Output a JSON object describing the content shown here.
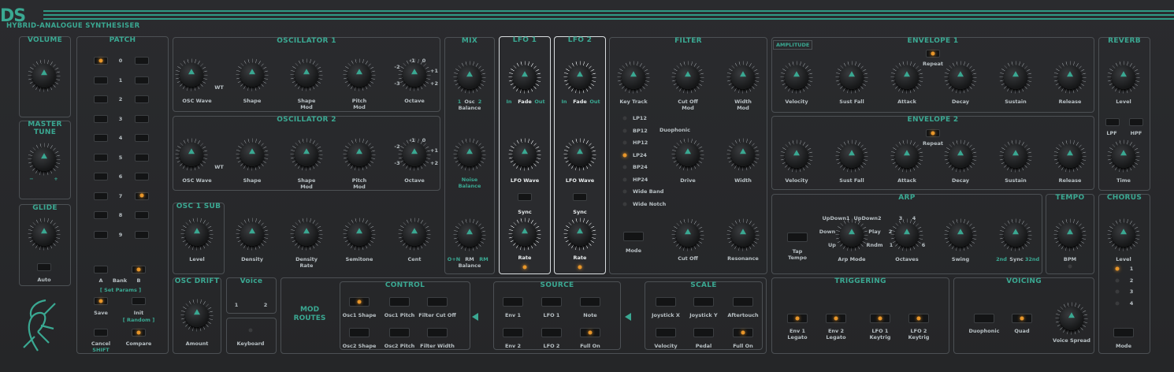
{
  "brand": {
    "logo": "DS",
    "subtitle": "HYBRID-ANALOGUE SYNTHESISER"
  },
  "sections": {
    "volume": "VOLUME",
    "master_tune": "MASTER TUNE",
    "glide": "GLIDE",
    "patch": "PATCH",
    "osc1": "OSCILLATOR 1",
    "osc2": "OSCILLATOR 2",
    "osc1_sub": "OSC 1 SUB",
    "osc_drift": "OSC DRIFT",
    "mix": "MIX",
    "lfo1": "LFO 1",
    "lfo2": "LFO 2",
    "filter": "FILTER",
    "amplitude": "AMPLITUDE",
    "env1": "ENVELOPE 1",
    "env2": "ENVELOPE 2",
    "reverb": "REVERB",
    "arp": "ARP",
    "tempo": "TEMPO",
    "chorus": "CHORUS",
    "control": "CONTROL",
    "source": "SOURCE",
    "scale": "SCALE",
    "triggering": "TRIGGERING",
    "voicing": "VOICING",
    "voice": "Voice"
  },
  "master": {
    "tune_minus": "−",
    "tune_plus": "+",
    "glide_auto": "Auto"
  },
  "patch": {
    "numbers": [
      "0",
      "1",
      "2",
      "3",
      "4",
      "5",
      "6",
      "7",
      "8",
      "9"
    ],
    "a": "A",
    "bank": "Bank",
    "b": "B",
    "set_params": "[ Set Params ]",
    "save": "Save",
    "init": "Init",
    "random": "[ Random ]",
    "cancel": "Cancel",
    "shift": "SHIFT",
    "compare": "Compare"
  },
  "osc1": {
    "wave": "OSC Wave",
    "wt": "WT",
    "shape": "Shape",
    "shape_mod": "Shape\nMod",
    "pitch_mod": "Pitch\nMod",
    "octave": "Octave",
    "oct": [
      "-2",
      "-1",
      "0",
      "+1",
      "+2",
      "-3"
    ]
  },
  "osc2": {
    "wave": "OSC Wave",
    "wt": "WT",
    "shape": "Shape",
    "shape_mod": "Shape\nMod",
    "pitch_mod": "Pitch\nMod",
    "octave": "Octave",
    "oct": [
      "-2",
      "-1",
      "0",
      "+1",
      "+2",
      "-3"
    ]
  },
  "sub": {
    "level": "Level",
    "density": "Density",
    "density_rate": "Density\nRate",
    "semitone": "Semitone",
    "cent": "Cent"
  },
  "drift": {
    "amount": "Amount",
    "keyboard": "Keyboard",
    "voice1": "1",
    "voice2": "2"
  },
  "mix": {
    "osc_balance": "Osc\nBalance",
    "osc1": "1",
    "osc2": "2",
    "noise_balance": "Noise\nBalance",
    "ring_balance": "RM\nBalance",
    "o_n": "O+N",
    "rm": "RM"
  },
  "lfo": {
    "in": "In",
    "fade": "Fade",
    "out": "Out",
    "wave": "LFO Wave",
    "sync": "Sync",
    "rate": "Rate"
  },
  "filter": {
    "key_track": "Key Track",
    "cutoff_mod": "Cut Off\nMod",
    "width_mod": "Width\nMod",
    "types": [
      "LP12",
      "BP12",
      "HP12",
      "LP24",
      "BP24",
      "HP24",
      "Wide Band",
      "Wide Notch"
    ],
    "duophonic": "Duophonic",
    "drive": "Drive",
    "width": "Width",
    "mode": "Mode",
    "cutoff": "Cut Off",
    "resonance": "Resonance"
  },
  "env": {
    "velocity": "Velocity",
    "sust_fall": "Sust Fall",
    "attack": "Attack",
    "decay": "Decay",
    "sustain": "Sustain",
    "release": "Release",
    "repeat": "Repeat"
  },
  "reverb": {
    "level": "Level",
    "lpf": "LPF",
    "hpf": "HPF",
    "time": "Time"
  },
  "arp": {
    "tap_tempo": "Tap\nTempo",
    "arp_mode": "Arp Mode",
    "octaves": "Octaves",
    "swing": "Swing",
    "modes": [
      "UpDown1",
      "UpDown2",
      "Down",
      "Play",
      "Up",
      "Rndm"
    ],
    "oct_vals": [
      "3",
      "4",
      "2",
      "1",
      "6"
    ],
    "sync_2nd": "2nd",
    "sync": "Sync",
    "sync_32nd": "32nd"
  },
  "tempo": {
    "bpm": "BPM"
  },
  "chorus": {
    "level": "Level",
    "modes": [
      "1",
      "2",
      "3",
      "4"
    ],
    "mode": "Mode"
  },
  "mod": {
    "routes": "MOD\nROUTES",
    "control": [
      "Osc1 Shape",
      "Osc1 Pitch",
      "Filter Cut Off",
      "Osc2 Shape",
      "Osc2 Pitch",
      "Filter Width"
    ],
    "source": [
      "Env 1",
      "LFO 1",
      "Note",
      "Env 2",
      "LFO 2",
      "Full On"
    ],
    "scale": [
      "Joystick X",
      "Joystick Y",
      "Aftertouch",
      "Velocity",
      "Pedal",
      "Full On"
    ]
  },
  "triggering": [
    "Env 1\nLegato",
    "Env 2\nLegato",
    "LFO 1\nKeytrig",
    "LFO 2\nKeytrig"
  ],
  "voicing": {
    "duophonic": "Duophonic",
    "quad": "Quad",
    "spread": "Voice Spread"
  },
  "colors": {
    "accent": "#3aa892",
    "led": "#e8962a",
    "panel": "#262729"
  }
}
